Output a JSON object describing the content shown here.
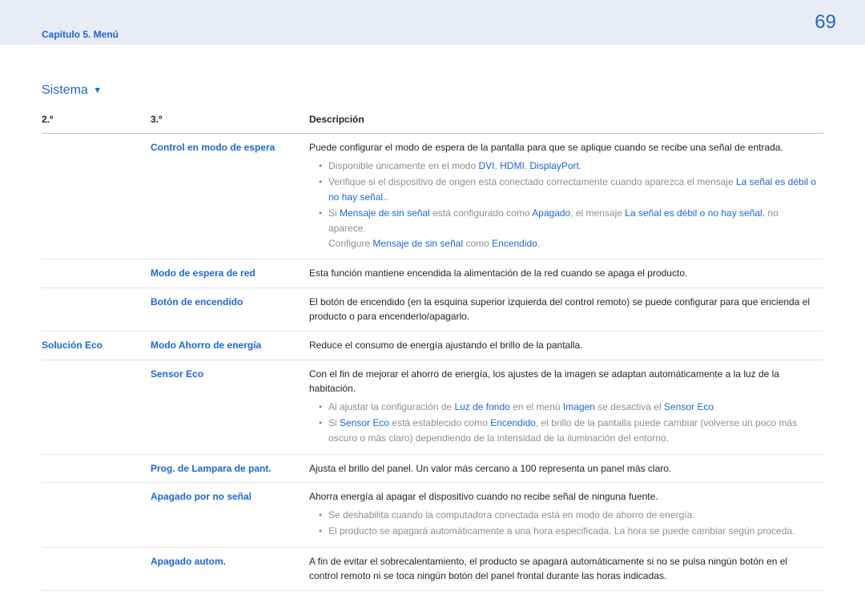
{
  "header": {
    "page_number": "69",
    "chapter": "Capítulo 5. Menú"
  },
  "section_title": "Sistema",
  "columns": {
    "c2": "2.º",
    "c3": "3.º",
    "desc": "Descripción"
  },
  "rows": {
    "r1": {
      "c3": "Control en modo de espera",
      "desc_intro": "Puede configurar el modo de espera de la pantalla para que se aplique cuando se recibe una señal de entrada.",
      "b1_pre": "Disponible únicamente en el modo ",
      "b1_dvi": "DVI",
      "b1_sep1": ", ",
      "b1_hdmi": "HDMI",
      "b1_sep2": ", ",
      "b1_dp": "DisplayPort",
      "b1_post": ".",
      "b2_pre": "Verifique si el dispositivo de origen está conectado correctamente cuando aparezca el mensaje ",
      "b2_link": "La señal es débil o no hay señal.",
      "b2_post": ".",
      "b3_pre": "Si ",
      "b3_msg": "Mensaje de sin señal",
      "b3_mid1": " está configurado como ",
      "b3_off": "Apagado",
      "b3_mid2": ", el mensaje ",
      "b3_link": "La señal es débil o no hay señal.",
      "b3_post": " no aparece.",
      "b3_line2a": "Configure ",
      "b3_line2_msg": "Mensaje de sin señal",
      "b3_line2b": " como ",
      "b3_line2_on": "Encendido",
      "b3_line2c": "."
    },
    "r2": {
      "c3": "Modo de espera de red",
      "desc": "Esta función mantiene encendida la alimentación de la red cuando se apaga el producto."
    },
    "r3": {
      "c3": "Botón de encendido",
      "desc": "El botón de encendido (en la esquina superior izquierda del control remoto) se puede configurar para que encienda el producto o para encenderlo/apagarlo."
    },
    "r4": {
      "c2": "Solución Eco",
      "c3": "Modo Ahorro de energía",
      "desc": "Reduce el consumo de energía ajustando el brillo de la pantalla."
    },
    "r5": {
      "c3": "Sensor Eco",
      "desc_intro": "Con el fin de mejorar el ahorro de energía, los ajustes de la imagen se adaptan automáticamente a la luz de la habitación.",
      "b1_pre": "Al ajustar la configuración de ",
      "b1_luz": "Luz de fondo",
      "b1_mid1": " en el menú ",
      "b1_imagen": "Imagen",
      "b1_mid2": " se desactiva el ",
      "b1_sensor": "Sensor Eco",
      "b1_post": ".",
      "b2_pre": "Si ",
      "b2_sensor": "Sensor Eco",
      "b2_mid1": " está establecido como ",
      "b2_on": "Encendido",
      "b2_post": ", el brillo de la pantalla puede cambiar (volverse un poco más oscuro o más claro) dependiendo de la intensidad de la iluminación del entorno."
    },
    "r6": {
      "c3": "Prog. de Lampara de pant.",
      "desc": "Ajusta el brillo del panel. Un valor más cercano a 100 representa un panel más claro."
    },
    "r7": {
      "c3": "Apagado por no señal",
      "desc_intro": "Ahorra energía al apagar el dispositivo cuando no recibe señal de ninguna fuente.",
      "b1": "Se deshabilita cuando la computadora conectada está en modo de ahorro de energía.",
      "b2": "El producto se apagará automáticamente a una hora especificada. La hora se puede cambiar según proceda."
    },
    "r8": {
      "c3": "Apagado autom.",
      "desc": "A fin de evitar el sobrecalentamiento, el producto se apagará automáticamente si no se pulsa ningún botón en el control remoto ni se toca ningún botón del panel frontal durante las horas indicadas."
    }
  }
}
